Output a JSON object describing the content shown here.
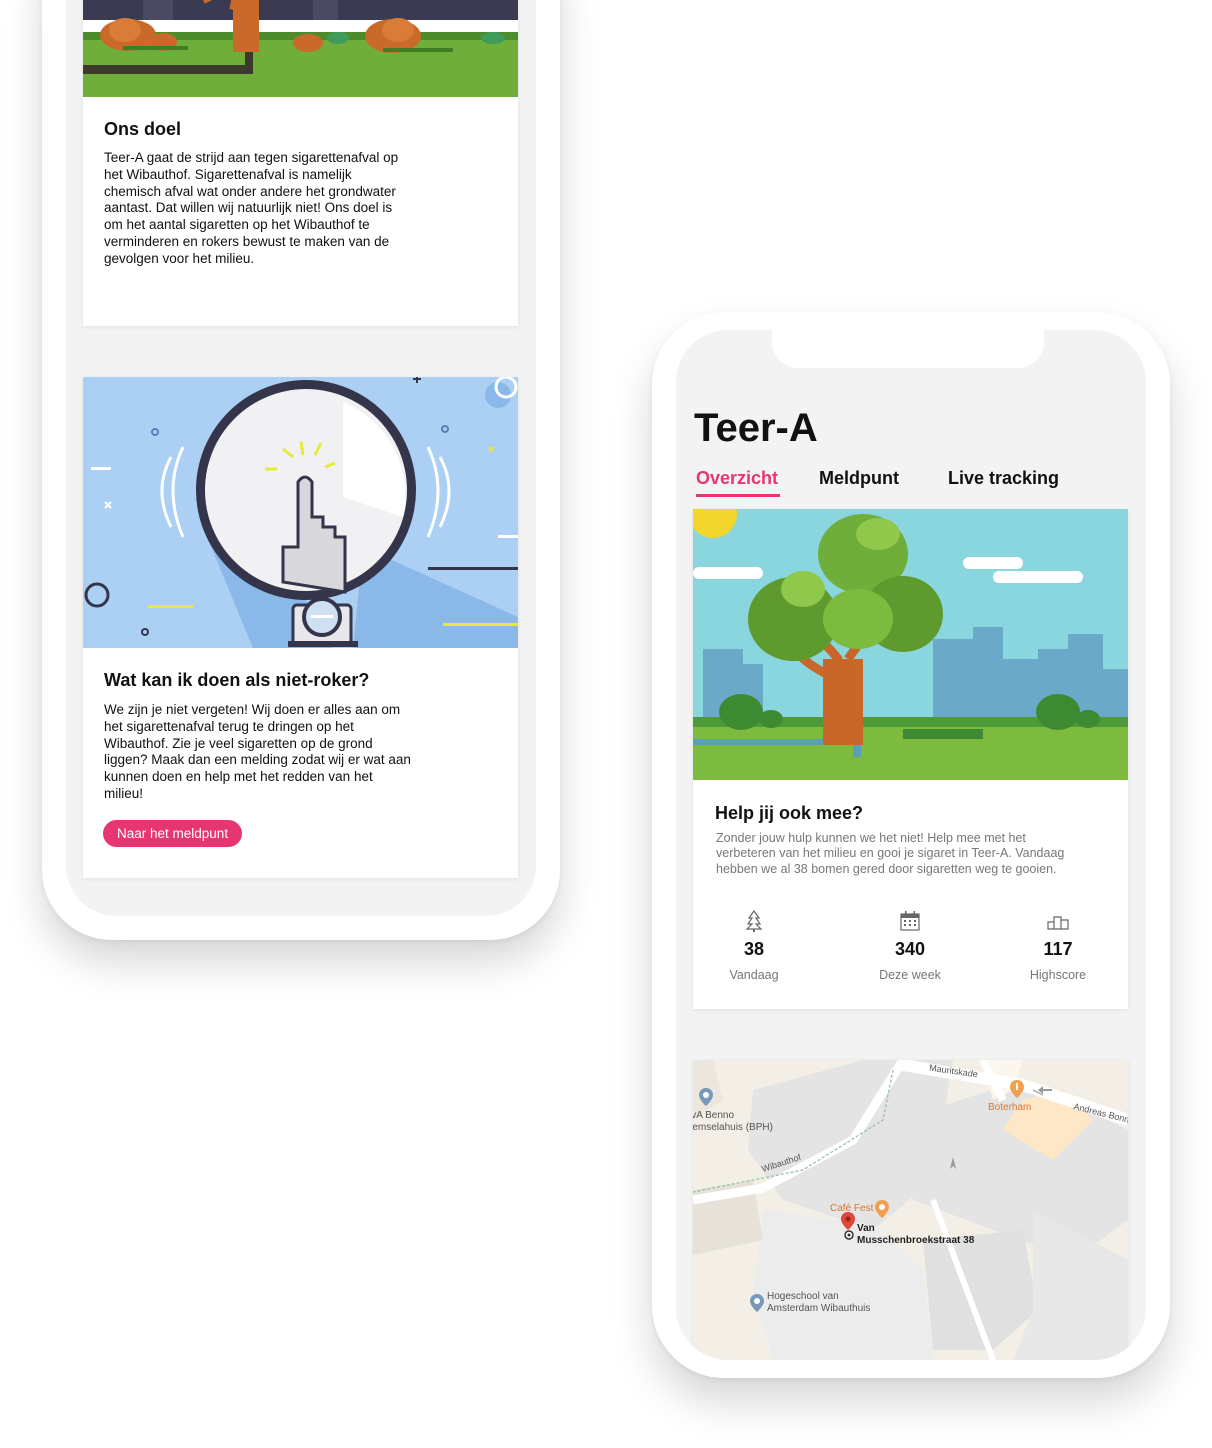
{
  "left_phone": {
    "goal_card": {
      "title": "Ons doel",
      "text": "Teer-A gaat de strijd aan tegen sigarettenafval op het Wibauthof. Sigarettenafval is namelijk chemisch afval wat onder andere het grondwater aantast. Dat willen wij natuurlijk niet! Ons doel is om het aantal sigaretten op het Wibauthof te verminderen en rokers bewust te maken van de gevolgen voor het milieu."
    },
    "nonsmoker_card": {
      "title": "Wat kan ik doen als niet-roker?",
      "text": "We zijn je niet vergeten! Wij doen er alles aan om het sigarettenafval terug te dringen op het Wibauthof. Zie je veel sigaretten op de grond liggen? Maak dan een melding zodat wij er wat aan kunnen doen en help met het redden van het milieu!",
      "button_label": "Naar het meldpunt"
    }
  },
  "right_phone": {
    "app_title": "Teer-A",
    "tabs": [
      {
        "label": "Overzicht",
        "active": true
      },
      {
        "label": "Meldpunt",
        "active": false
      },
      {
        "label": "Live tracking",
        "active": false
      }
    ],
    "help_card": {
      "title": "Help jij ook mee?",
      "text": "Zonder jouw hulp kunnen we het niet! Help mee met het verbeteren van het milieu en gooi je sigaret in Teer-A. Vandaag hebben we al 38 bomen gered door sigaretten weg te gooien.",
      "stats": [
        {
          "icon": "tree-icon",
          "value": "38",
          "label": "Vandaag"
        },
        {
          "icon": "calendar-icon",
          "value": "340",
          "label": "Deze week"
        },
        {
          "icon": "podium-icon",
          "value": "117",
          "label": "Highscore"
        }
      ]
    },
    "map": {
      "labels": {
        "street_mauritskade": "Mauritskade",
        "boterham": "Boterham",
        "street_andreas": "Andreas Bonn",
        "hva_line1": "lvA Benno",
        "hva_line2": "remselahuis (BPH)",
        "street_wibauthof": "Wibauthof",
        "cafe": "Café Fest",
        "pin_line1": "Van",
        "pin_line2": "Musschenbroekstraat 38",
        "hogeschool_line1": "Hogeschool van",
        "hogeschool_line2": "Amsterdam Wibauthuis"
      }
    }
  },
  "colors": {
    "accent": "#e73572",
    "background": "#f3f3f3",
    "map_pin": "#e0463a",
    "poi_orange": "#f2a04e",
    "poi_blue": "#7a99b8"
  }
}
